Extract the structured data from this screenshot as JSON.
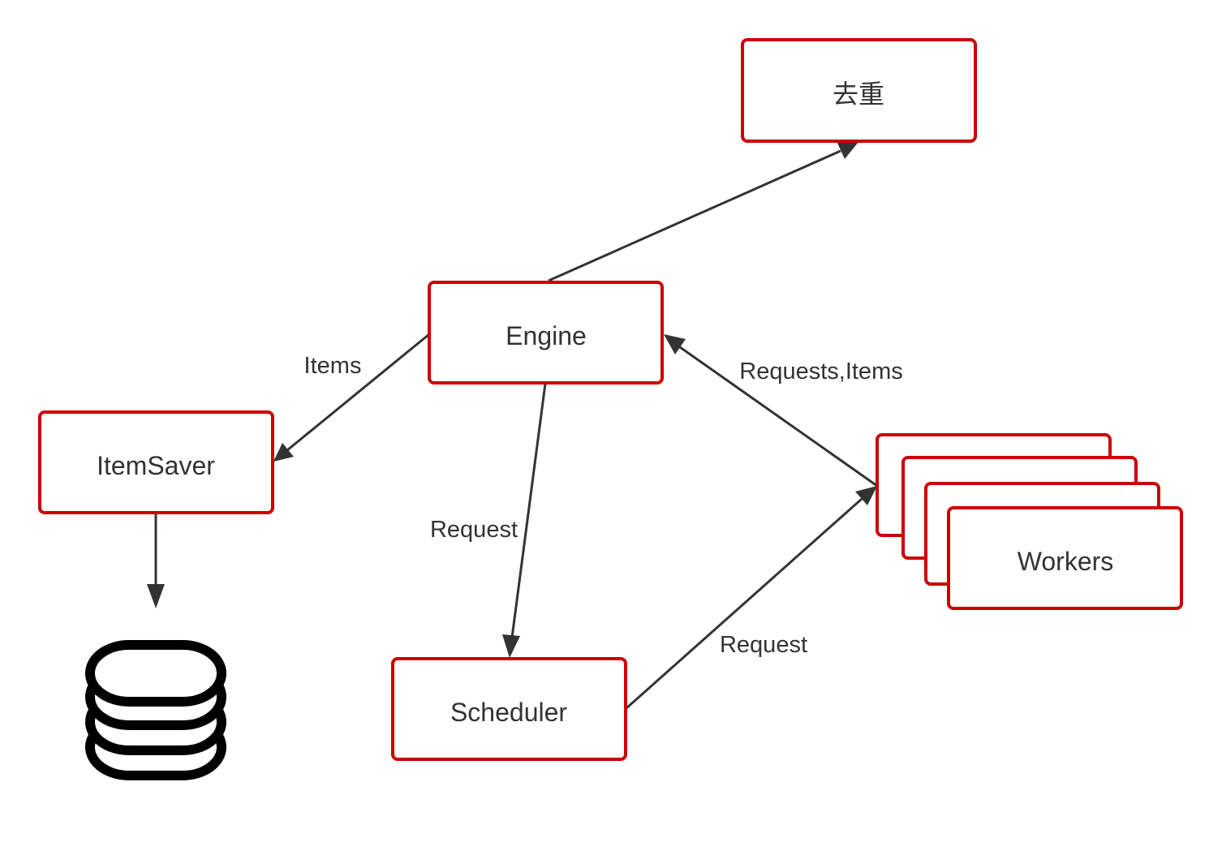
{
  "nodes": {
    "dedup": "去重",
    "engine": "Engine",
    "item_saver": "ItemSaver",
    "scheduler": "Scheduler",
    "workers": "Workers"
  },
  "edges": {
    "engine_to_itemsaver": "Items",
    "engine_to_scheduler": "Request",
    "scheduler_to_workers": "Request",
    "workers_to_engine": "Requests,Items"
  },
  "icons": {
    "storage": "database-icon"
  },
  "colors": {
    "node_border": "#cc0000",
    "line": "#333333",
    "text": "#333333"
  }
}
